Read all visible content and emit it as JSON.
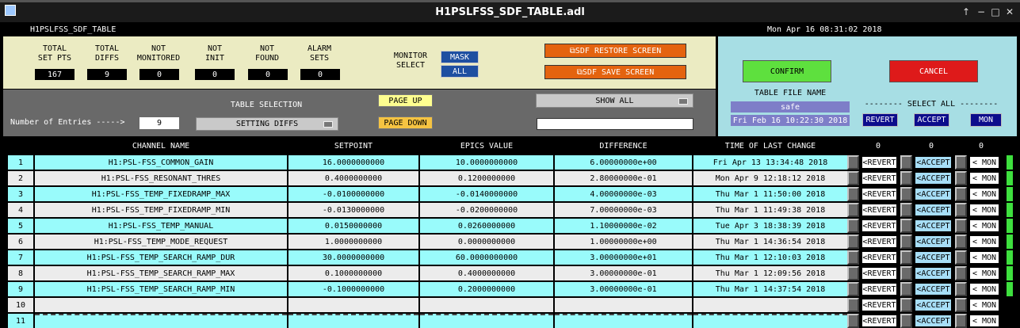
{
  "window": {
    "title": "H1PSLFSS_SDF_TABLE.adl",
    "controls": [
      "↑",
      "−",
      "□",
      "✕"
    ]
  },
  "header": {
    "name": "H1PSLFSS_SDF_TABLE",
    "datetime": "Mon Apr 16 08:31:02 2018"
  },
  "summary": {
    "stats": [
      {
        "label": "TOTAL\nSET PTS",
        "value": "167"
      },
      {
        "label": "TOTAL\nDIFFS",
        "value": "9"
      },
      {
        "label": "NOT\nMONITORED",
        "value": "0"
      },
      {
        "label": "NOT\nINIT",
        "value": "0"
      },
      {
        "label": "NOT\nFOUND",
        "value": "0"
      },
      {
        "label": "ALARM\nSETS",
        "value": "0"
      }
    ],
    "monitor_select": {
      "label": "MONITOR\nSELECT",
      "mask": "MASK",
      "all": "ALL"
    },
    "restore_button": "⧉SDF RESTORE SCREEN",
    "save_button": "⧉SDF SAVE SCREEN"
  },
  "table_controls": {
    "entries_label": "Number of Entries ----->",
    "entries_value": "9",
    "table_selection_label": "TABLE SELECTION",
    "table_selection_value": "SETTING DIFFS",
    "page_up": "PAGE UP",
    "page_down": "PAGE DOWN",
    "show_all": "SHOW ALL",
    "filter_value": ""
  },
  "confirm": {
    "confirm_button": "CONFIRM",
    "cancel_button": "CANCEL",
    "table_file_label": "TABLE FILE NAME",
    "table_file_name": "safe",
    "table_file_date": "Fri Feb 16 10:22:30 2018",
    "select_all_label": "-------- SELECT ALL --------",
    "revert": "REVERT",
    "accept": "ACCEPT",
    "mon": "MON"
  },
  "table": {
    "headers": [
      "CHANNEL NAME",
      "SETPOINT",
      "EPICS VALUE",
      "DIFFERENCE",
      "TIME OF LAST CHANGE"
    ],
    "counts": [
      "0",
      "0",
      "0"
    ],
    "revert_label": "<REVERT",
    "accept_label": "<ACCEPT",
    "mon_label": "< MON",
    "rows": [
      {
        "idx": "1",
        "channel": "H1:PSL-FSS_COMMON_GAIN",
        "setpoint": "16.0000000000",
        "epics": "10.0000000000",
        "diff": "6.00000000e+00",
        "time": "Fri Apr 13 13:34:48 2018"
      },
      {
        "idx": "2",
        "channel": "H1:PSL-FSS_RESONANT_THRES",
        "setpoint": "0.4000000000",
        "epics": "0.1200000000",
        "diff": "2.80000000e-01",
        "time": "Mon Apr  9 12:18:12 2018"
      },
      {
        "idx": "3",
        "channel": "H1:PSL-FSS_TEMP_FIXEDRAMP_MAX",
        "setpoint": "-0.0100000000",
        "epics": "-0.0140000000",
        "diff": "4.00000000e-03",
        "time": "Thu Mar  1 11:50:00 2018"
      },
      {
        "idx": "4",
        "channel": "H1:PSL-FSS_TEMP_FIXEDRAMP_MIN",
        "setpoint": "-0.0130000000",
        "epics": "-0.0200000000",
        "diff": "7.00000000e-03",
        "time": "Thu Mar  1 11:49:38 2018"
      },
      {
        "idx": "5",
        "channel": "H1:PSL-FSS_TEMP_MANUAL",
        "setpoint": "0.0150000000",
        "epics": "0.0260000000",
        "diff": "1.10000000e-02",
        "time": "Tue Apr  3 18:38:39 2018"
      },
      {
        "idx": "6",
        "channel": "H1:PSL-FSS_TEMP_MODE_REQUEST",
        "setpoint": "1.0000000000",
        "epics": "0.0000000000",
        "diff": "1.00000000e+00",
        "time": "Thu Mar  1 14:36:54 2018"
      },
      {
        "idx": "7",
        "channel": "H1:PSL-FSS_TEMP_SEARCH_RAMP_DUR",
        "setpoint": "30.0000000000",
        "epics": "60.0000000000",
        "diff": "3.00000000e+01",
        "time": "Thu Mar  1 12:10:03 2018"
      },
      {
        "idx": "8",
        "channel": "H1:PSL-FSS_TEMP_SEARCH_RAMP_MAX",
        "setpoint": "0.1000000000",
        "epics": "0.4000000000",
        "diff": "3.00000000e-01",
        "time": "Thu Mar  1 12:09:56 2018"
      },
      {
        "idx": "9",
        "channel": "H1:PSL-FSS_TEMP_SEARCH_RAMP_MIN",
        "setpoint": "-0.1000000000",
        "epics": "0.2000000000",
        "diff": "3.00000000e-01",
        "time": "Thu Mar  1 14:37:54 2018"
      },
      {
        "idx": "10",
        "channel": "",
        "setpoint": "",
        "epics": "",
        "diff": "",
        "time": ""
      },
      {
        "idx": "11",
        "channel": "",
        "setpoint": "",
        "epics": "",
        "diff": "",
        "time": ""
      }
    ]
  },
  "colors": {
    "row_cyan": "#99fbfb",
    "row_light": "#ececec",
    "summary_bg": "#ebebc2",
    "confirm_bg": "#a7dee4",
    "accent_green": "#3ee03e"
  }
}
